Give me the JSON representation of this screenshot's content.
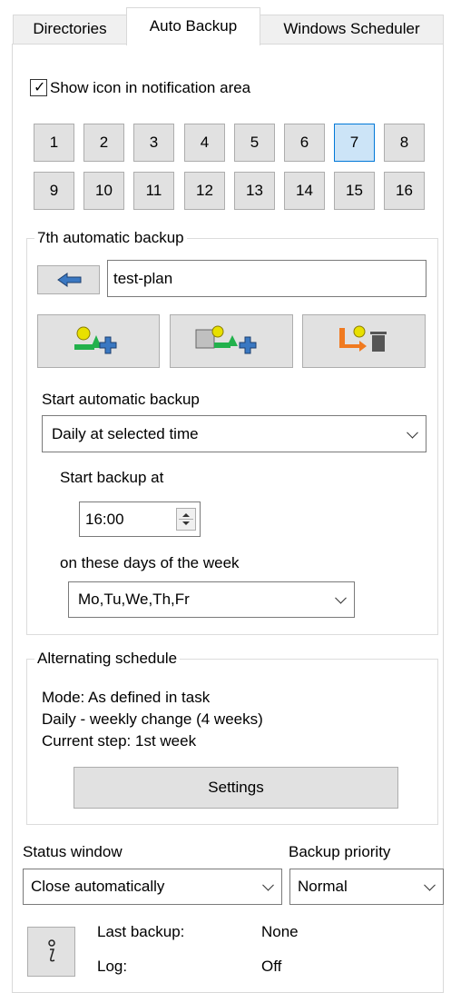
{
  "tabs": [
    {
      "label": "Directories"
    },
    {
      "label": "Auto Backup"
    },
    {
      "label": "Windows Scheduler"
    }
  ],
  "active_tab": "Auto Backup",
  "notification": {
    "label": "Show icon in notification area",
    "checked": true
  },
  "numbers": [
    "1",
    "2",
    "3",
    "4",
    "5",
    "6",
    "7",
    "8",
    "9",
    "10",
    "11",
    "12",
    "13",
    "14",
    "15",
    "16"
  ],
  "selected_number": "7",
  "backup_group": {
    "title": "7th  automatic backup",
    "name_value": "test-plan",
    "start_label": "Start automatic backup",
    "start_select": "Daily at selected time",
    "start_at_label": "Start backup at",
    "time_value": "16:00",
    "days_label": "on these days of the week",
    "days_select": "Mo,Tu,We,Th,Fr"
  },
  "alt_group": {
    "title": "Alternating schedule",
    "mode": "Mode: As defined in task",
    "daily": "Daily - weekly change (4 weeks)",
    "step": "Current step: 1st  week",
    "settings_button": "Settings"
  },
  "status": {
    "label": "Status window",
    "select": "Close automatically"
  },
  "priority": {
    "label": "Backup priority",
    "select": "Normal"
  },
  "info": {
    "last_backup_label": "Last backup:",
    "last_backup_value": "None",
    "log_label": "Log:",
    "log_value": "Off"
  },
  "colors": {
    "selected_button": "#cce4f7",
    "selected_border": "#0078d7",
    "button_face": "#e1e1e1",
    "icon_yellow": "#e8e000",
    "icon_green": "#22b14c",
    "icon_orange": "#f07a20",
    "icon_blue": "#3a78c2"
  }
}
